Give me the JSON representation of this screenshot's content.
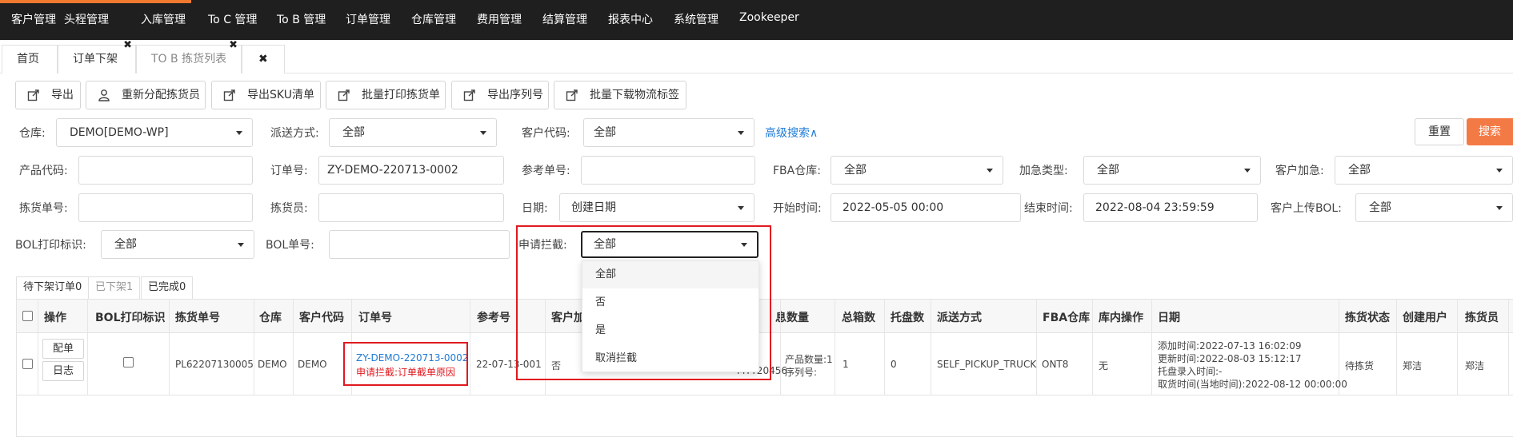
{
  "topnav": {
    "items": [
      "客户管理",
      "头程管理",
      "入库管理",
      "To C 管理",
      "To B 管理",
      "订单管理",
      "仓库管理",
      "费用管理",
      "结算管理",
      "报表中心",
      "系统管理",
      "Zookeeper"
    ],
    "accent_color": "#f0782f"
  },
  "tabs": {
    "home": "首页",
    "order_shelf": "订单下架",
    "tob_pick": "TO B 拣货列表",
    "close_all_icon": "close-icon"
  },
  "toolbar": {
    "export": "导出",
    "reassign": "重新分配拣货员",
    "export_sku": "导出SKU清单",
    "batch_print": "批量打印拣货单",
    "export_serial": "导出序列号",
    "batch_label": "批量下载物流标签"
  },
  "filters": {
    "warehouse_label": "仓库:",
    "warehouse_value": "DEMO[DEMO-WP]",
    "delivery_label": "派送方式:",
    "delivery_value": "全部",
    "customer_code_label": "客户代码:",
    "customer_code_value": "全部",
    "advanced_search": "高级搜索∧",
    "reset": "重置",
    "search": "搜索",
    "product_code_label": "产品代码:",
    "order_no_label": "订单号:",
    "order_no_value": "ZY-DEMO-220713-0002",
    "ref_no_label": "参考单号:",
    "fba_wh_label": "FBA仓库:",
    "fba_wh_value": "全部",
    "urgent_type_label": "加急类型:",
    "urgent_type_value": "全部",
    "customer_urgent_label": "客户加急:",
    "customer_urgent_value": "全部",
    "pick_no_label": "拣货单号:",
    "picker_label": "拣货员:",
    "date_label": "日期:",
    "date_value": "创建日期",
    "start_label": "开始时间:",
    "start_value": "2022-05-05 00:00",
    "end_label": "结束时间:",
    "end_value": "2022-08-04 23:59:59",
    "bol_upload_label": "客户上传BOL:",
    "bol_upload_value": "全部",
    "bol_print_label": "BOL打印标识:",
    "bol_print_value": "全部",
    "bol_no_label": "BOL单号:",
    "intercept_label": "申请拦截:",
    "intercept_value": "全部",
    "intercept_options": [
      "全部",
      "否",
      "是",
      "取消拦截"
    ]
  },
  "subtabs": [
    "待下架订单0",
    "已下架1",
    "已完成0"
  ],
  "table": {
    "headers": [
      "操作",
      "BOL打印标识",
      "拣货单号",
      "仓库",
      "客户代码",
      "订单号",
      "参考号",
      "客户加",
      "息",
      "数量",
      "总箱数",
      "托盘数",
      "派送方式",
      "FBA仓库",
      "库内操作",
      "日期",
      "拣货状态",
      "创建用户",
      "拣货员"
    ],
    "row": {
      "btn_allocate": "配单",
      "btn_log": "日志",
      "pick_no": "PL62207130005",
      "warehouse": "DEMO",
      "customer_code": "DEMO",
      "order_no": "ZY-DEMO-220713-0002",
      "intercept_note": "申请拦截:订单截单原因",
      "ref_no": "22-07-13-001",
      "customer_urgent": "否",
      "info_partial": "MTT20456",
      "qty_line1": "产品数量:1",
      "qty_line2": "序列号:",
      "total_boxes": "1",
      "pallets": "0",
      "delivery": "SELF_PICKUP_TRUCK",
      "fba_wh": "ONT8",
      "inwh_op": "无",
      "date_line1": "添加时间:2022-07-13 16:02:09",
      "date_line2": "更新时间:2022-08-03 15:12:17",
      "date_line3": "托盘录入时间:-",
      "date_line4": "取货时间(当地时间):2022-08-12 00:00:00",
      "pick_status": "待拣货",
      "creator": "郑洁",
      "picker": "郑洁"
    }
  },
  "colors": {
    "highlight": "#e0191f",
    "link": "#1e7bd6",
    "search_button": "#f47a45"
  }
}
